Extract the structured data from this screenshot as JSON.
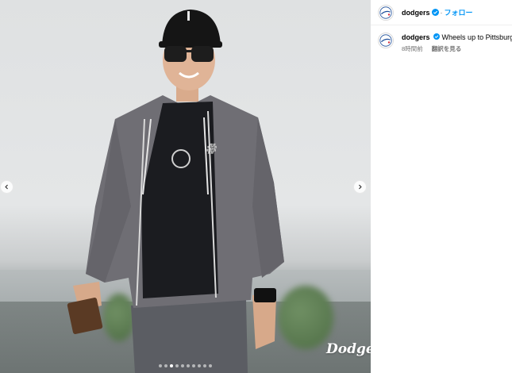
{
  "post": {
    "watermark": "Dodgers",
    "carousel": {
      "total_slides": 10,
      "active_index": 2
    }
  },
  "header": {
    "username": "dodgers",
    "separator": "·",
    "follow_label": "フォロー"
  },
  "caption": {
    "username": "dodgers",
    "text": "Wheels up to Pittsburgh.",
    "timestamp": "8時間前",
    "translate_label": "翻訳を見る"
  },
  "colors": {
    "verified": "#0095f6",
    "follow": "#0095f6",
    "muted": "#737373"
  }
}
